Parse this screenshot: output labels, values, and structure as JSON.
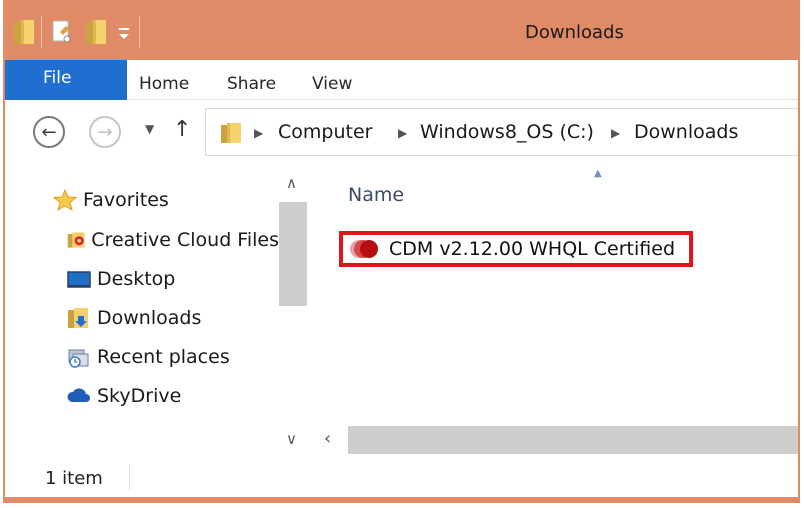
{
  "window": {
    "title": "Downloads",
    "accent_color": "#e08a66",
    "quick_access_icons": [
      "folder-icon",
      "properties-icon",
      "new-folder-icon",
      "customize-dropdown-icon"
    ]
  },
  "ribbon": {
    "tabs": [
      {
        "label": "File",
        "active_color": "#1f6fd1"
      },
      {
        "label": "Home"
      },
      {
        "label": "Share"
      },
      {
        "label": "View"
      }
    ]
  },
  "address": {
    "breadcrumbs": [
      "Computer",
      "Windows8_OS (C:)",
      "Downloads"
    ],
    "icons": [
      "back-arrow-icon",
      "forward-arrow-icon",
      "chevron-down-icon",
      "up-arrow-icon",
      "folder-icon",
      "chevron-right-icon"
    ]
  },
  "nav_pane": {
    "items": [
      {
        "label": "Favorites",
        "icon": "star-icon"
      },
      {
        "label": "Creative Cloud Files",
        "icon": "creative-cloud-folder-icon"
      },
      {
        "label": "Desktop",
        "icon": "desktop-icon"
      },
      {
        "label": "Downloads",
        "icon": "downloads-folder-icon"
      },
      {
        "label": "Recent places",
        "icon": "recent-places-icon"
      },
      {
        "label": "SkyDrive",
        "icon": "cloud-icon"
      }
    ]
  },
  "content": {
    "column_header": "Name",
    "files": [
      {
        "name": "CDM v2.12.00 WHQL Certified",
        "icon": "installer-icon",
        "highlight_color": "#e0151c"
      }
    ]
  },
  "statusbar": {
    "item_count": "1 item"
  }
}
